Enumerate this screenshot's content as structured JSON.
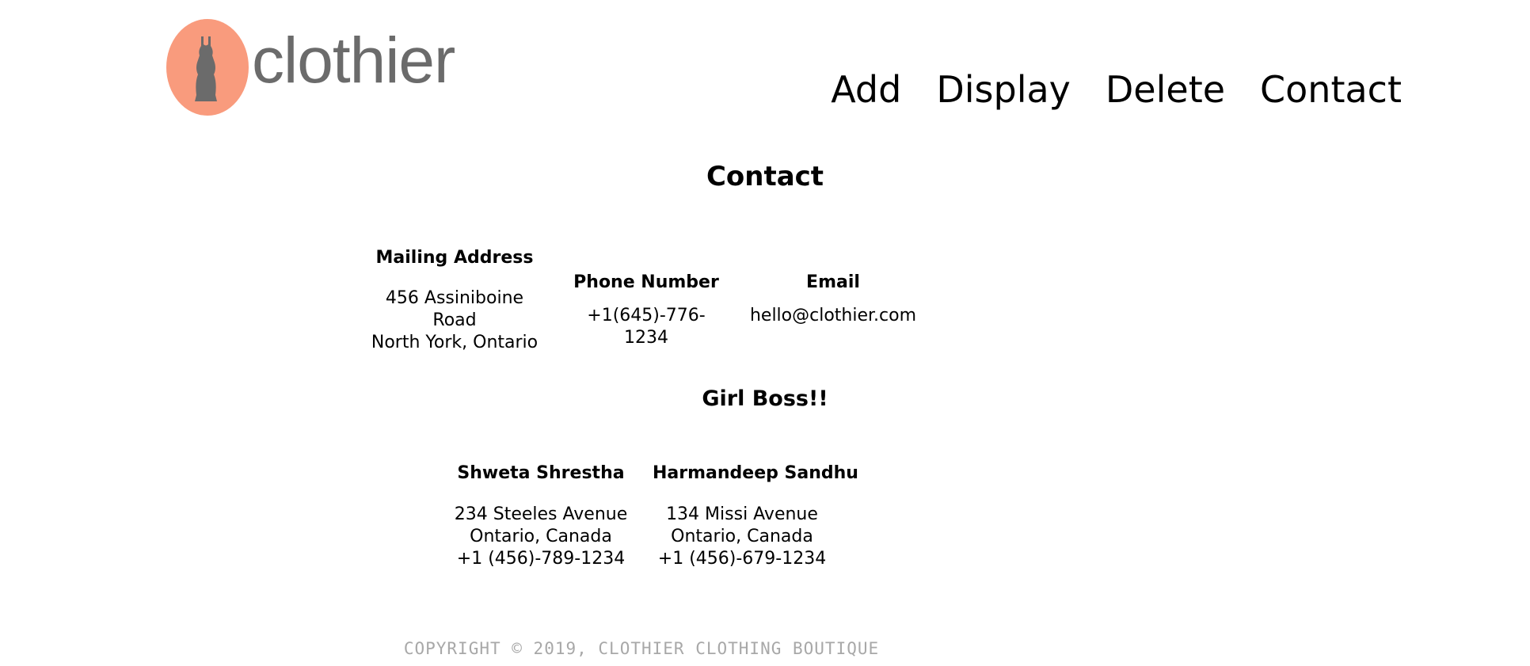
{
  "brand": {
    "name": "clothier",
    "logo_icon": "dress-icon",
    "logo_color": "#f99b7d",
    "text_color": "#6b6b6b"
  },
  "nav": {
    "items": [
      {
        "label": "Add"
      },
      {
        "label": "Display"
      },
      {
        "label": "Delete"
      },
      {
        "label": "Contact"
      }
    ]
  },
  "page": {
    "title": "Contact"
  },
  "contact": {
    "mailing": {
      "heading": "Mailing Address",
      "line1": "456 Assiniboine Road",
      "line2": "North York, Ontario"
    },
    "phone": {
      "heading": "Phone Number",
      "value": "+1(645)-776-1234"
    },
    "email": {
      "heading": "Email",
      "value": "hello@clothier.com"
    }
  },
  "bosses": {
    "title": "Girl Boss!!",
    "people": [
      {
        "name": "Shweta Shrestha",
        "line1": "234 Steeles Avenue",
        "line2": "Ontario, Canada",
        "phone": "+1 (456)-789-1234"
      },
      {
        "name": "Harmandeep Sandhu",
        "line1": "134 Missi Avenue",
        "line2": "Ontario, Canada",
        "phone": "+1 (456)-679-1234"
      }
    ]
  },
  "footer": {
    "text": "COPYRIGHT © 2019, CLOTHIER CLOTHING BOUTIQUE",
    "color": "#a8a8a8"
  }
}
